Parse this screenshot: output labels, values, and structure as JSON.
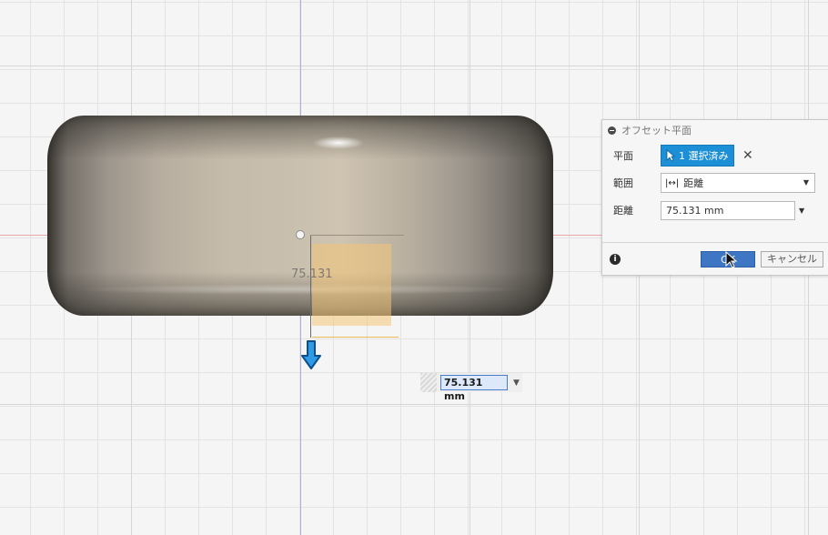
{
  "canvas": {
    "distance_label": "75.131",
    "inline_value": "75.131 mm"
  },
  "dialog": {
    "title": "オフセット平面",
    "plane_label": "平面",
    "plane_selection": "1 選択済み",
    "clear_symbol": "✕",
    "extent_label": "範囲",
    "extent_value": "距離",
    "distance_label": "距離",
    "distance_value": "75.131 mm",
    "ok_label": "OK",
    "cancel_label": "キャンセル",
    "info_symbol": "i"
  },
  "icons": {
    "drag_arrow": "arrow-down-icon",
    "extent": "distance-icon",
    "collapse": "minus-circle-icon"
  },
  "colors": {
    "accent": "#1d8fd6",
    "ok": "#3f76c4",
    "preview_plane": "#f3c476"
  }
}
